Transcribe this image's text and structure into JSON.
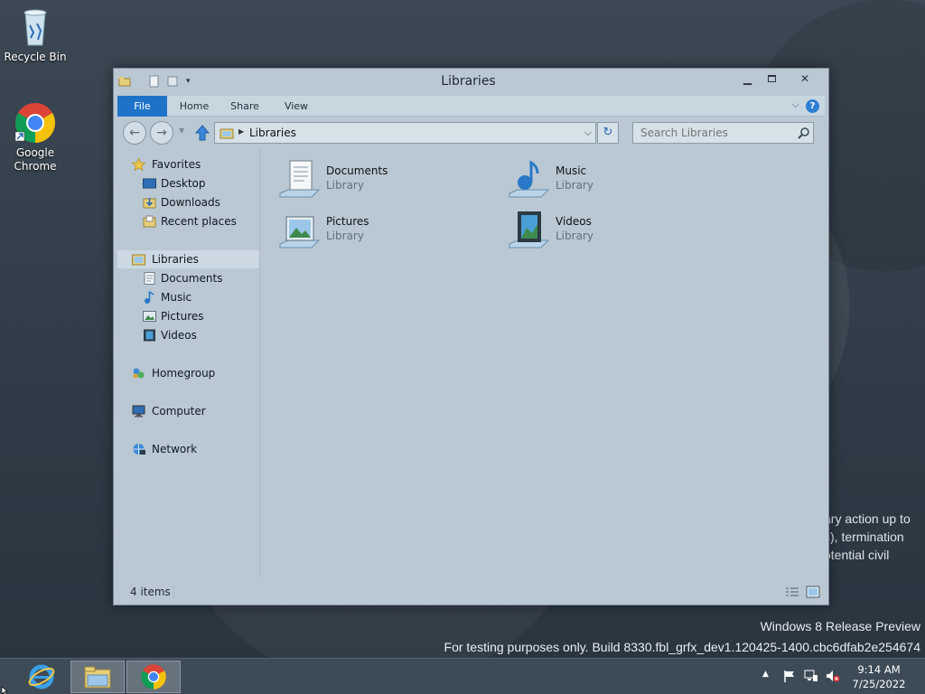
{
  "desktop": {
    "icons": [
      {
        "label": "Recycle Bin",
        "icon": "recycle-bin-icon"
      },
      {
        "label": "Google Chrome",
        "icon": "chrome-icon"
      }
    ],
    "watermark_lines": [
      "ary action up to",
      "s), termination",
      "otential civil"
    ],
    "build_line1": "Windows 8 Release Preview",
    "build_line2": "For testing purposes only. Build 8330.fbl_grfx_dev1.120425-1400.cbc6dfab2e254674"
  },
  "window": {
    "title": "Libraries",
    "ribbon_tabs": [
      "File",
      "Home",
      "Share",
      "View"
    ],
    "ribbon_help": "?",
    "address": "Libraries",
    "search_placeholder": "Search Libraries",
    "nav_pane": {
      "favorites": {
        "label": "Favorites",
        "icon": "star-icon"
      },
      "favorites_items": [
        {
          "label": "Desktop",
          "icon": "desktop-icon"
        },
        {
          "label": "Downloads",
          "icon": "downloads-icon"
        },
        {
          "label": "Recent places",
          "icon": "recent-places-icon"
        }
      ],
      "libraries": {
        "label": "Libraries",
        "icon": "libraries-icon"
      },
      "libraries_items": [
        {
          "label": "Documents",
          "icon": "documents-icon"
        },
        {
          "label": "Music",
          "icon": "music-icon"
        },
        {
          "label": "Pictures",
          "icon": "pictures-icon"
        },
        {
          "label": "Videos",
          "icon": "videos-icon"
        }
      ],
      "homegroup": {
        "label": "Homegroup",
        "icon": "homegroup-icon"
      },
      "computer": {
        "label": "Computer",
        "icon": "computer-icon"
      },
      "network": {
        "label": "Network",
        "icon": "network-icon"
      }
    },
    "content_items": [
      {
        "name": "Documents",
        "type": "Library",
        "icon": "documents-library-icon"
      },
      {
        "name": "Music",
        "type": "Library",
        "icon": "music-library-icon"
      },
      {
        "name": "Pictures",
        "type": "Library",
        "icon": "pictures-library-icon"
      },
      {
        "name": "Videos",
        "type": "Library",
        "icon": "videos-library-icon"
      }
    ],
    "status": {
      "item_count": "4 items"
    }
  },
  "taskbar": {
    "buttons": [
      {
        "name": "internet-explorer",
        "icon": "ie-icon"
      },
      {
        "name": "file-explorer",
        "icon": "folder-icon",
        "active": true
      },
      {
        "name": "chrome",
        "icon": "chrome-icon",
        "active": true
      }
    ],
    "clock_time": "9:14 AM",
    "clock_date": "7/25/2022"
  },
  "colors": {
    "accent": "#1e73c8",
    "window_bg": "#b9c8d3",
    "taskbar_bg": "#3d4b57"
  }
}
